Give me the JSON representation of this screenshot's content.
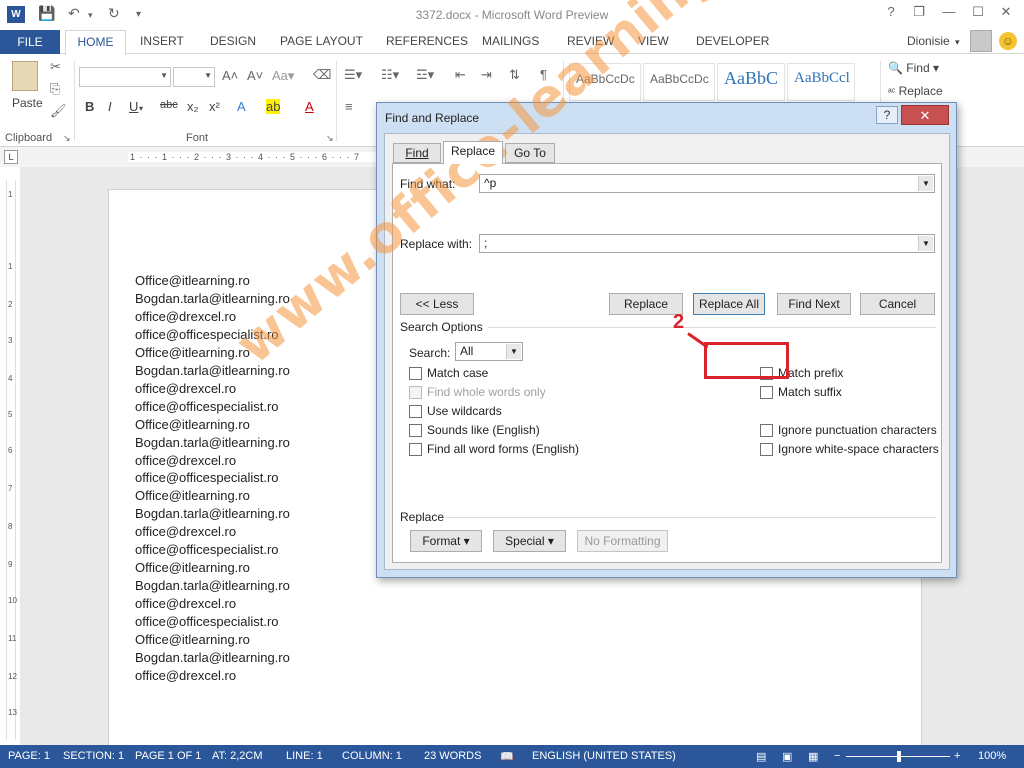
{
  "window": {
    "title": "3372.docx - Microsoft Word Preview"
  },
  "qat": {
    "app_icon": "W",
    "save_icon": "save-icon",
    "undo_icon": "undo-icon",
    "redo_icon": "redo-icon"
  },
  "window_controls": {
    "help": "?",
    "restore": "❐",
    "minimize": "—",
    "maximize": "☐",
    "close": "✕"
  },
  "tabs": {
    "file": "FILE",
    "home": "HOME",
    "insert": "INSERT",
    "design": "DESIGN",
    "page_layout": "PAGE LAYOUT",
    "references": "REFERENCES",
    "mailings": "MAILINGS",
    "review": "REVIEW",
    "view": "VIEW",
    "developer": "DEVELOPER"
  },
  "user": {
    "name": "Dionisie"
  },
  "ribbon": {
    "paste_label": "Paste",
    "clipboard_label": "Clipboard",
    "font_label": "Font",
    "styles": [
      "AaBbCcDc",
      "AaBbCcDc",
      "AaBbC",
      "AaBbCcl"
    ],
    "find_label": "Find",
    "replace_label": "Replace"
  },
  "ruler": {
    "ticks": "1 · · · 1 · · · 2 · · · 3 · · · 4 · · · 5 · · · 6 · · · 7",
    "tabstop": "L"
  },
  "document": {
    "lines": [
      "Office@itlearning.ro",
      "Bogdan.tarla@itlearning.ro",
      "office@drexcel.ro",
      "office@officespecialist.ro",
      "Office@itlearning.ro",
      "Bogdan.tarla@itlearning.ro",
      "office@drexcel.ro",
      "office@officespecialist.ro",
      "Office@itlearning.ro",
      "Bogdan.tarla@itlearning.ro",
      "office@drexcel.ro",
      "office@officespecialist.ro",
      "Office@itlearning.ro",
      "Bogdan.tarla@itlearning.ro",
      "office@drexcel.ro",
      "office@officespecialist.ro",
      "Office@itlearning.ro",
      "Bogdan.tarla@itlearning.ro",
      "office@drexcel.ro",
      "office@officespecialist.ro",
      "Office@itlearning.ro",
      "Bogdan.tarla@itlearning.ro",
      "office@drexcel.ro"
    ]
  },
  "dialog": {
    "title": "Find and Replace",
    "help": "?",
    "close": "✕",
    "tabs": {
      "find": "Find",
      "replace": "Replace",
      "goto": "Go To"
    },
    "find_what_label": "Find what:",
    "find_what_value": "^p",
    "replace_with_label": "Replace with:",
    "replace_with_value": ";",
    "buttons": {
      "less": "<< Less",
      "replace": "Replace",
      "replace_all": "Replace All",
      "find_next": "Find Next",
      "cancel": "Cancel"
    },
    "annotation": "2",
    "search_options_label": "Search Options",
    "search_label": "Search:",
    "search_value": "All",
    "options_left": [
      {
        "label": "Match case",
        "checked": false,
        "disabled": false
      },
      {
        "label": "Find whole words only",
        "checked": false,
        "disabled": true
      },
      {
        "label": "Use wildcards",
        "checked": false,
        "disabled": false
      },
      {
        "label": "Sounds like (English)",
        "checked": false,
        "disabled": false
      },
      {
        "label": "Find all word forms (English)",
        "checked": false,
        "disabled": false
      }
    ],
    "options_right": [
      {
        "label": "Match prefix",
        "checked": false
      },
      {
        "label": "Match suffix",
        "checked": false
      },
      {
        "label": "Ignore punctuation characters",
        "checked": false
      },
      {
        "label": "Ignore white-space characters",
        "checked": false
      }
    ],
    "replace_section_label": "Replace",
    "format_button": "Format ▾",
    "special_button": "Special ▾",
    "no_formatting_button": "No Formatting"
  },
  "status": {
    "page": "PAGE: 1",
    "section": "SECTION: 1",
    "page_of": "PAGE 1 OF 1",
    "at": "AT: 2,2CM",
    "line": "LINE: 1",
    "column": "COLUMN: 1",
    "words": "23 WORDS",
    "language": "ENGLISH (UNITED STATES)",
    "zoom": "100%",
    "zoom_minus": "−",
    "zoom_plus": "+"
  },
  "watermark": "www.office-learning.ro"
}
